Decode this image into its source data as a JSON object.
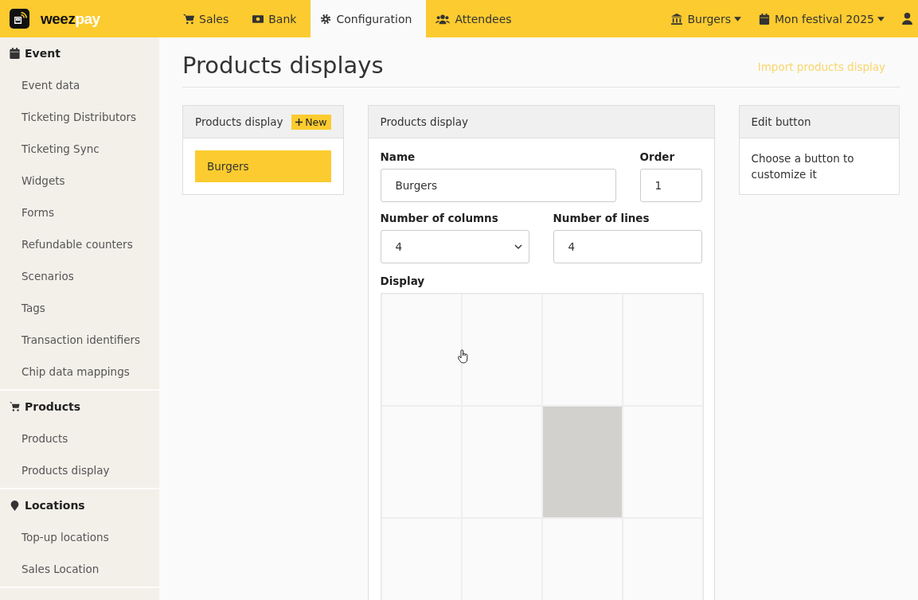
{
  "brand": {
    "name_dark": "weez",
    "name_light": "pay"
  },
  "nav": [
    {
      "label": "Sales",
      "kind": "cart",
      "selected": false
    },
    {
      "label": "Bank",
      "kind": "money",
      "selected": false
    },
    {
      "label": "Configuration",
      "kind": "gear",
      "selected": true
    },
    {
      "label": "Attendees",
      "kind": "users",
      "selected": false
    }
  ],
  "context": [
    {
      "label": "Burgers",
      "kind": "bank"
    },
    {
      "label": "Mon festival 2025",
      "kind": "calendar"
    }
  ],
  "sidebar": [
    {
      "title": "Event",
      "kind": "calendar",
      "items": [
        "Event data",
        "Ticketing Distributors",
        "Ticketing Sync",
        "Widgets",
        "Forms",
        "Refundable counters",
        "Scenarios",
        "Tags",
        "Transaction identifiers",
        "Chip data mappings"
      ]
    },
    {
      "title": "Products",
      "kind": "cart",
      "items": [
        "Products",
        "Products display"
      ]
    },
    {
      "title": "Locations",
      "kind": "pin",
      "items": [
        "Top-up locations",
        "Sales Location"
      ]
    }
  ],
  "page": {
    "title": "Products displays",
    "import_link": "Import products display"
  },
  "list_panel": {
    "title": "Products display",
    "new_button": "New",
    "items": [
      {
        "label": "Burgers",
        "selected": true
      }
    ]
  },
  "form_panel": {
    "title": "Products display",
    "name_label": "Name",
    "name_value": "Burgers",
    "order_label": "Order",
    "order_value": "1",
    "columns_label": "Number of columns",
    "columns_value": "4",
    "lines_label": "Number of lines",
    "lines_value": "4",
    "display_label": "Display",
    "cells": [
      {
        "selected": false
      },
      {
        "selected": false
      },
      {
        "selected": false
      },
      {
        "selected": false
      },
      {
        "selected": false
      },
      {
        "selected": false
      },
      {
        "selected": true
      },
      {
        "selected": false
      },
      {
        "selected": false
      },
      {
        "selected": false
      },
      {
        "selected": false
      },
      {
        "selected": false
      }
    ]
  },
  "edit_panel": {
    "title": "Edit button",
    "text": "Choose a button to customize it"
  }
}
